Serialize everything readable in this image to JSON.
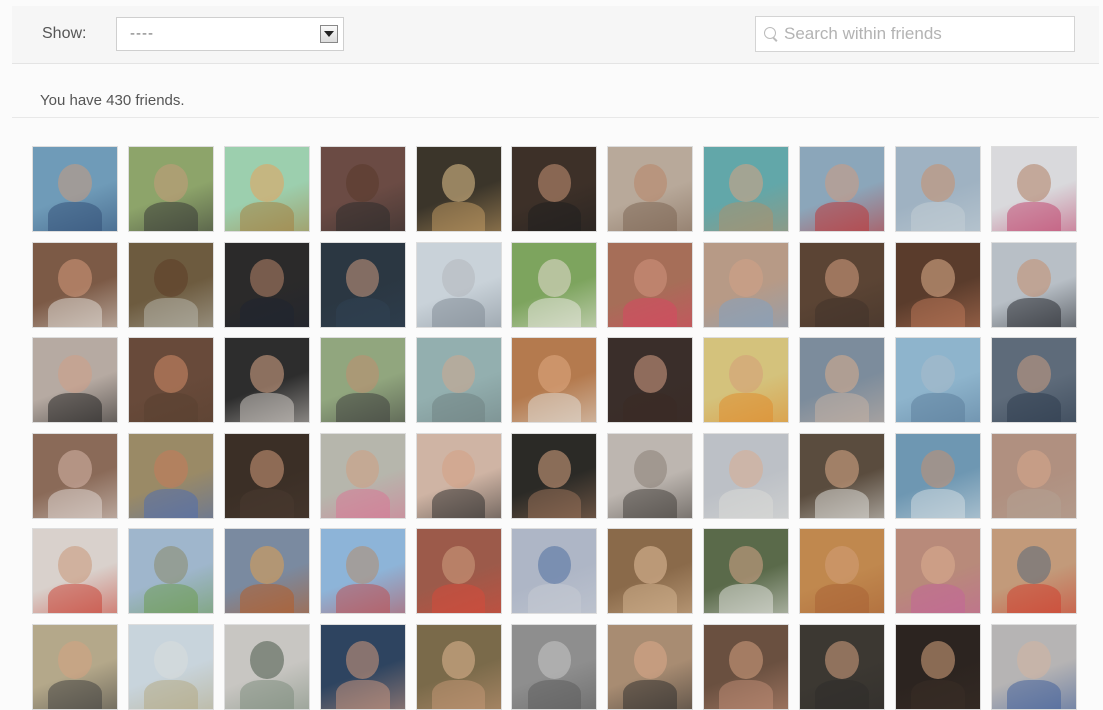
{
  "toolbar": {
    "show_label": "Show:",
    "filter_value": "----",
    "search_placeholder": "Search within friends"
  },
  "friends_count_text": "You have 430 friends.",
  "friends": [
    {
      "bg": "#6f9bb8",
      "face": "#c99b7e",
      "body": "#2f4b73"
    },
    {
      "bg": "#8da46a",
      "face": "#c79a7a",
      "body": "#333333"
    },
    {
      "bg": "#9ccfae",
      "face": "#e8a35c",
      "body": "#a67c3a"
    },
    {
      "bg": "#6b4b44",
      "face": "#5a3a2c",
      "body": "#2a2a2a"
    },
    {
      "bg": "#3b352a",
      "face": "#e6c58e",
      "body": "#c8a065"
    },
    {
      "bg": "#3d3028",
      "face": "#c99676",
      "body": "#1e1e1e"
    },
    {
      "bg": "#b8a99a",
      "face": "#b88568",
      "body": "#7a6250"
    },
    {
      "bg": "#62a7a9",
      "face": "#d8a281",
      "body": "#b08f6a"
    },
    {
      "bg": "#8ba6ba",
      "face": "#d09b80",
      "body": "#c03030"
    },
    {
      "bg": "#9fb2c2",
      "face": "#c98f6c",
      "body": "#c6d0d6"
    },
    {
      "bg": "#d9d9dc",
      "face": "#b08064",
      "body": "#c0406a"
    },
    {
      "bg": "#7c5a46",
      "face": "#d59b7c",
      "body": "#e4e0da"
    },
    {
      "bg": "#6d5b3f",
      "face": "#5c3d26",
      "body": "#b9b9b0"
    },
    {
      "bg": "#2b2a2a",
      "face": "#b8856a",
      "body": "#1e2330"
    },
    {
      "bg": "#2b3742",
      "face": "#cc9a80",
      "body": "#2f4154"
    },
    {
      "bg": "#c9d2d9",
      "face": "#b2b7bb",
      "body": "#7e8891"
    },
    {
      "bg": "#7da45e",
      "face": "#e7ddd3",
      "body": "#efece7"
    },
    {
      "bg": "#a66e58",
      "face": "#d19580",
      "body": "#d94662"
    },
    {
      "bg": "#b79a86",
      "face": "#d3a286",
      "body": "#7fa2c4"
    },
    {
      "bg": "#5b4434",
      "face": "#d5a081",
      "body": "#40322a"
    },
    {
      "bg": "#5a3c2c",
      "face": "#e0b08e",
      "body": "#c07a5a"
    },
    {
      "bg": "#b8bfc6",
      "face": "#c58e6e",
      "body": "#1f2228"
    },
    {
      "bg": "#b6aaa2",
      "face": "#cf9e86",
      "body": "#1c1c1c"
    },
    {
      "bg": "#684a3a",
      "face": "#d28d68",
      "body": "#584030"
    },
    {
      "bg": "#2d2d2d",
      "face": "#dba888",
      "body": "#d8d2cc"
    },
    {
      "bg": "#91a67e",
      "face": "#bf8e70",
      "body": "#3a3a3a"
    },
    {
      "bg": "#93afaf",
      "face": "#d0a88e",
      "body": "#6e7f80"
    },
    {
      "bg": "#b47a4e",
      "face": "#e0a981",
      "body": "#e4e2dc"
    },
    {
      "bg": "#3a2e2a",
      "face": "#d5a085",
      "body": "#3a2a24"
    },
    {
      "bg": "#d4c27c",
      "face": "#d39e78",
      "body": "#e08a2a"
    },
    {
      "bg": "#7c8c9c",
      "face": "#d9ad8c",
      "body": "#c9b4a4"
    },
    {
      "bg": "#8eb4cc",
      "face": "#a9bccb",
      "body": "#5a7c9a"
    },
    {
      "bg": "#5e6b7a",
      "face": "#c89c82",
      "body": "#2c3a4c"
    },
    {
      "bg": "#8a6a58",
      "face": "#d7b7a9",
      "body": "#e3dcd8"
    },
    {
      "bg": "#9a8a66",
      "face": "#c77a5a",
      "body": "#4c6cb2"
    },
    {
      "bg": "#3b2f26",
      "face": "#d39c7c",
      "body": "#4a3a30"
    },
    {
      "bg": "#b6b6ac",
      "face": "#cf9f82",
      "body": "#d97494"
    },
    {
      "bg": "#cfb4a4",
      "face": "#d6a184",
      "body": "#2a2a2a"
    },
    {
      "bg": "#2b2a26",
      "face": "#d8a482",
      "body": "#a0765c"
    },
    {
      "bg": "#bdb6b0",
      "face": "#8a8076",
      "body": "#3e3a36"
    },
    {
      "bg": "#bcc0c6",
      "face": "#d8ac90",
      "body": "#dcdcd8"
    },
    {
      "bg": "#5a4c3e",
      "face": "#dcac88",
      "body": "#e4e4e0"
    },
    {
      "bg": "#6e97b2",
      "face": "#c69070",
      "body": "#d8e0e4"
    },
    {
      "bg": "#b09080",
      "face": "#d9a78a",
      "body": "#b4a294"
    },
    {
      "bg": "#d9d1cc",
      "face": "#c99878",
      "body": "#c83c2e"
    },
    {
      "bg": "#9fb6cc",
      "face": "#8a8a6a",
      "body": "#6a9a4a"
    },
    {
      "bg": "#7a8aa0",
      "face": "#e0a050",
      "body": "#b85a20"
    },
    {
      "bg": "#8db4d8",
      "face": "#b48c6c",
      "body": "#c04a4a"
    },
    {
      "bg": "#9c5a4a",
      "face": "#d0a080",
      "body": "#d84a3a"
    },
    {
      "bg": "#aeb6c6",
      "face": "#5070a0",
      "body": "#c8ccd4"
    },
    {
      "bg": "#8a6a4a",
      "face": "#e4c09c",
      "body": "#d8b894"
    },
    {
      "bg": "#5a6a4a",
      "face": "#d6a488",
      "body": "#e8e8e4"
    },
    {
      "bg": "#c0884e",
      "face": "#d29e78",
      "body": "#a86034"
    },
    {
      "bg": "#b88a7a",
      "face": "#dcae90",
      "body": "#c4649a"
    },
    {
      "bg": "#c29a7a",
      "face": "#5a6a7a",
      "body": "#d03a2a"
    },
    {
      "bg": "#b4a88a",
      "face": "#d6a282",
      "body": "#3c3c3c"
    },
    {
      "bg": "#c8d4dc",
      "face": "#d8dcdc",
      "body": "#b4a880"
    },
    {
      "bg": "#c8c6c2",
      "face": "#4a5a4a",
      "body": "#7a8a7a"
    },
    {
      "bg": "#2e4460",
      "face": "#d39a7c",
      "body": "#d09a80"
    },
    {
      "bg": "#7a6a4a",
      "face": "#e2b894",
      "body": "#c89a78"
    },
    {
      "bg": "#8e8e8e",
      "face": "#c8c8c8",
      "body": "#5a5a5a"
    },
    {
      "bg": "#a88c72",
      "face": "#dcaa8a",
      "body": "#2c2c2c"
    },
    {
      "bg": "#6a5040",
      "face": "#d4a080",
      "body": "#c49078"
    },
    {
      "bg": "#3c3832",
      "face": "#d6a282",
      "body": "#2e2c2a"
    },
    {
      "bg": "#2c2420",
      "face": "#d8a680",
      "body": "#3a2e26"
    },
    {
      "bg": "#b6b4b4",
      "face": "#d4b4a0",
      "body": "#3c5c9a"
    }
  ]
}
